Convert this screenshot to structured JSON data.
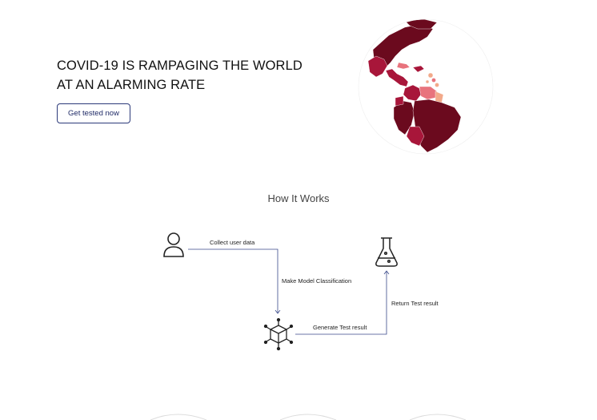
{
  "hero": {
    "title_line1": "COVID-19 IS RAMPAGING THE WORLD",
    "title_line2": "AT AN ALARMING RATE",
    "cta_label": "Get tested now"
  },
  "how_it_works": {
    "title": "How It Works",
    "steps": {
      "collect": "Collect user data",
      "classify": "Make Model Classification",
      "generate": "Generate Test result",
      "return": "Return Test result"
    },
    "icons": {
      "user": "user-icon",
      "model": "cube-network-icon",
      "lab": "flask-icon"
    }
  },
  "colors": {
    "accent": "#1f2a66",
    "globe_dark": "#6b0a1e",
    "globe_mid": "#a8163a",
    "globe_light": "#e8737d",
    "globe_pale": "#f2a98a"
  }
}
